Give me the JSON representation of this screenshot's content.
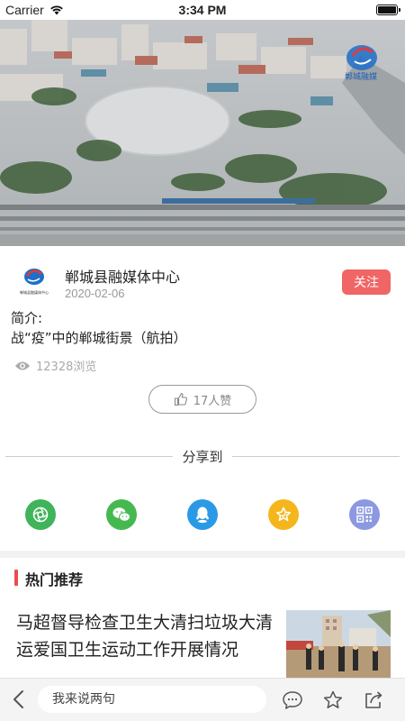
{
  "status_bar": {
    "carrier": "Carrier",
    "time": "3:34 PM"
  },
  "hero": {
    "watermark": "郸城融媒"
  },
  "publisher": {
    "name": "郸城县融媒体中心",
    "date": "2020-02-06",
    "follow_label": "关注",
    "logo_caption": "郸城县融媒体中心"
  },
  "intro": {
    "label": "简介:",
    "text": "战“疫”中的郸城街景（航拍）"
  },
  "stats": {
    "views": "12328浏览",
    "likes": "17人赞"
  },
  "share": {
    "title": "分享到",
    "targets": [
      {
        "icon": "camera-shutter-icon",
        "color": "#3fb45a"
      },
      {
        "icon": "wechat-icon",
        "color": "#45b94f"
      },
      {
        "icon": "qq-icon",
        "color": "#2b9ae6"
      },
      {
        "icon": "star-icon",
        "color": "#f5b51c"
      },
      {
        "icon": "qr-code-icon",
        "color": "#8c98e0"
      }
    ]
  },
  "recommend": {
    "title": "热门推荐",
    "items": [
      {
        "title": "马超督导检查卫生大清扫垃圾大清运爱国卫生运动工作开展情况"
      }
    ]
  },
  "bottom_bar": {
    "comment_placeholder": "我来说两句"
  },
  "colors": {
    "accent_red": "#f06565",
    "section_bar": "#ea4d4d"
  }
}
